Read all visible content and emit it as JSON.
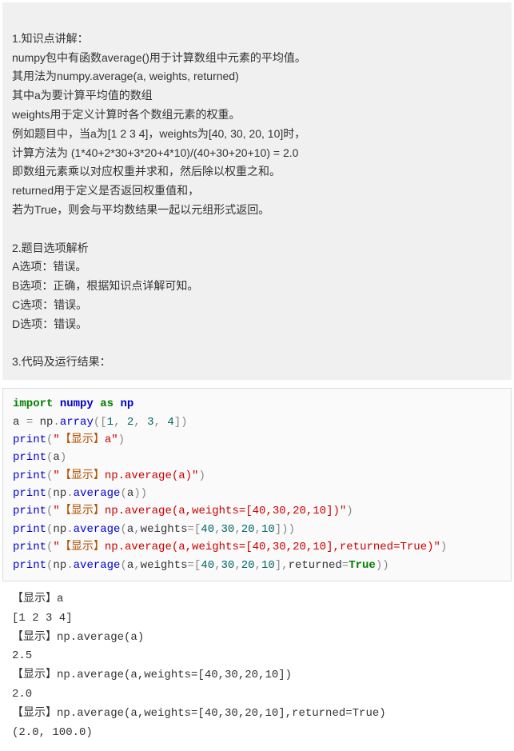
{
  "explanation": {
    "lines": [
      "1.知识点讲解：",
      "numpy包中有函数average()用于计算数组中元素的平均值。",
      "其用法为numpy.average(a, weights, returned)",
      "其中a为要计算平均值的数组",
      "weights用于定义计算时各个数组元素的权重。",
      "例如题目中，当a为[1 2 3 4]，weights为[40, 30, 20, 10]时，",
      "计算方法为 (1*40+2*30+3*20+4*10)/(40+30+20+10) = 2.0",
      "即数组元素乘以对应权重并求和，然后除以权重之和。",
      "returned用于定义是否返回权重值和，",
      "若为True，则会与平均数结果一起以元组形式返回。",
      "",
      "2.题目选项解析",
      "A选项：错误。",
      "B选项：正确，根据知识点详解可知。",
      "C选项：错误。",
      "D选项：错误。",
      "",
      "3.代码及运行结果："
    ]
  },
  "code": {
    "kw_import": "import",
    "kw_as": "as",
    "mod_numpy": "numpy",
    "mod_np": "np",
    "var_a": "a",
    "eq": "=",
    "dot": ".",
    "lpar": "(",
    "rpar": ")",
    "lbrk": "[",
    "rbrk": "]",
    "comma": ",",
    "fn_array": "array",
    "fn_print": "print",
    "fn_average": "average",
    "arg_weights": "weights",
    "arg_returned": "returned",
    "kw_true": "True",
    "nums_1234": [
      "1",
      "2",
      "3",
      "4"
    ],
    "nums_weights": [
      "40",
      "30",
      "20",
      "10"
    ],
    "q": "\"",
    "disp": "【显示】",
    "s_a": "a",
    "s_avg1": "np.average(a)",
    "s_avg2": "np.average(a,weights=[40,30,20,10])",
    "s_avg3": "np.average(a,weights=[40,30,20,10],returned=True)"
  },
  "output": {
    "lines": [
      "【显示】a",
      "[1 2 3 4]",
      "【显示】np.average(a)",
      "2.5",
      "【显示】np.average(a,weights=[40,30,20,10])",
      "2.0",
      "【显示】np.average(a,weights=[40,30,20,10],returned=True)",
      "(2.0, 100.0)"
    ]
  },
  "chart_data": {
    "type": "table",
    "title": "numpy.average weighted mean example",
    "a": [
      1,
      2,
      3,
      4
    ],
    "weights": [
      40,
      30,
      20,
      10
    ],
    "average_unweighted": 2.5,
    "average_weighted": 2.0,
    "returned_tuple": [
      2.0,
      100.0
    ],
    "formula": "(1*40+2*30+3*20+4*10)/(40+30+20+10) = 2.0"
  }
}
